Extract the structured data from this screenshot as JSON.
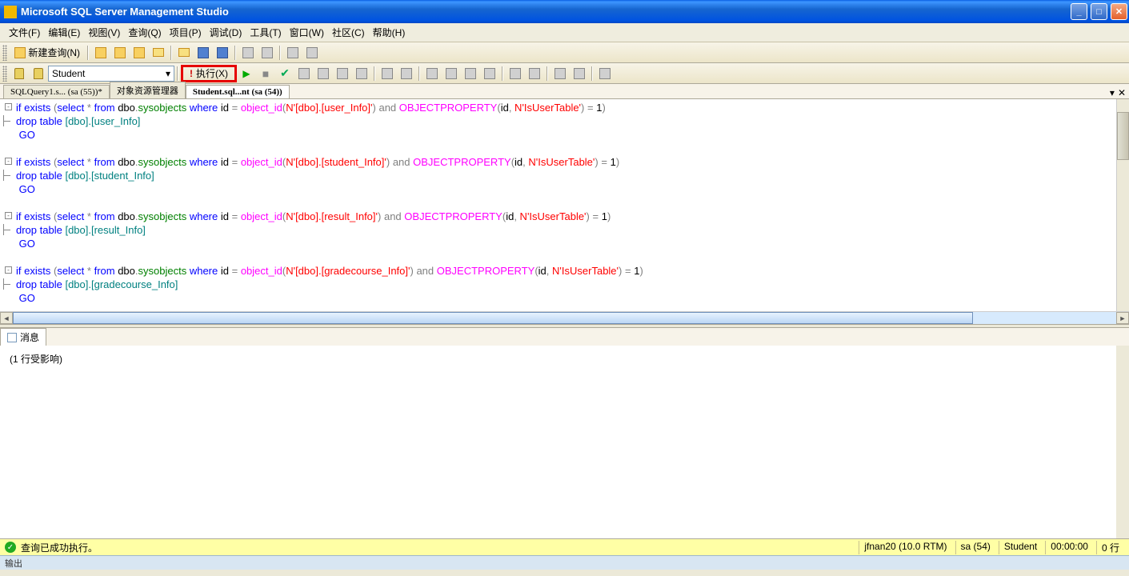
{
  "window": {
    "title": "Microsoft SQL Server Management Studio"
  },
  "menu": {
    "file": "文件(F)",
    "edit": "编辑(E)",
    "view": "视图(V)",
    "query": "查询(Q)",
    "project": "项目(P)",
    "debug": "调试(D)",
    "tools": "工具(T)",
    "window": "窗口(W)",
    "community": "社区(C)",
    "help": "帮助(H)"
  },
  "toolbar": {
    "new_query": "新建查询(N)"
  },
  "toolbar2": {
    "database": "Student",
    "execute": "执行(X)"
  },
  "tabs": {
    "tab1": "SQLQuery1.s... (sa (55))*",
    "tab2": "对象资源管理器",
    "tab3": "Student.sql...nt (sa (54))"
  },
  "messages": {
    "tab_label": "消息",
    "content": "(1 行受影响)"
  },
  "status": {
    "left": "查询已成功执行。",
    "server": "jfnan20 (10.0 RTM)",
    "user": "sa (54)",
    "db": "Student",
    "time": "00:00:00",
    "rows": "0 行"
  },
  "footer": {
    "text": "输出"
  },
  "code": {
    "l1_if": "if",
    "l1_exists": " exists ",
    "l1_p1": "(",
    "l1_select": "select",
    "l1_star": " * ",
    "l1_from": "from",
    "l1_sp1": " dbo",
    "l1_dot": ".",
    "l1_sysobj": "sysobjects ",
    "l1_where": "where",
    "l1_sp2": " id ",
    "l1_eq": "=",
    "l1_sp3": " ",
    "l1_objid": "object_id",
    "l1_p2": "(",
    "l1_n": "N'[dbo].[user_Info]'",
    "l1_p3": ")",
    "l1_and": " and ",
    "l1_op": "OBJECTPROPERTY",
    "l1_p4": "(",
    "l1_id": "id",
    "l1_c": ",",
    "l1_n2": " N'IsUserTable'",
    "l1_p5": ")",
    "l1_eq2": " = ",
    "l1_one": "1",
    "l1_p6": ")",
    "l2_drop": "drop",
    "l2_table": " table ",
    "l2_t": "[dbo].[user_Info]",
    "go": "GO",
    "l4_n": "N'[dbo].[student_Info]'",
    "l5_t": "[dbo].[student_Info]",
    "l7_n": "N'[dbo].[result_Info]'",
    "l8_t": "[dbo].[result_Info]",
    "l10_n": "N'[dbo].[gradecourse_Info]'",
    "l11_t": "[dbo].[gradecourse_Info]"
  }
}
